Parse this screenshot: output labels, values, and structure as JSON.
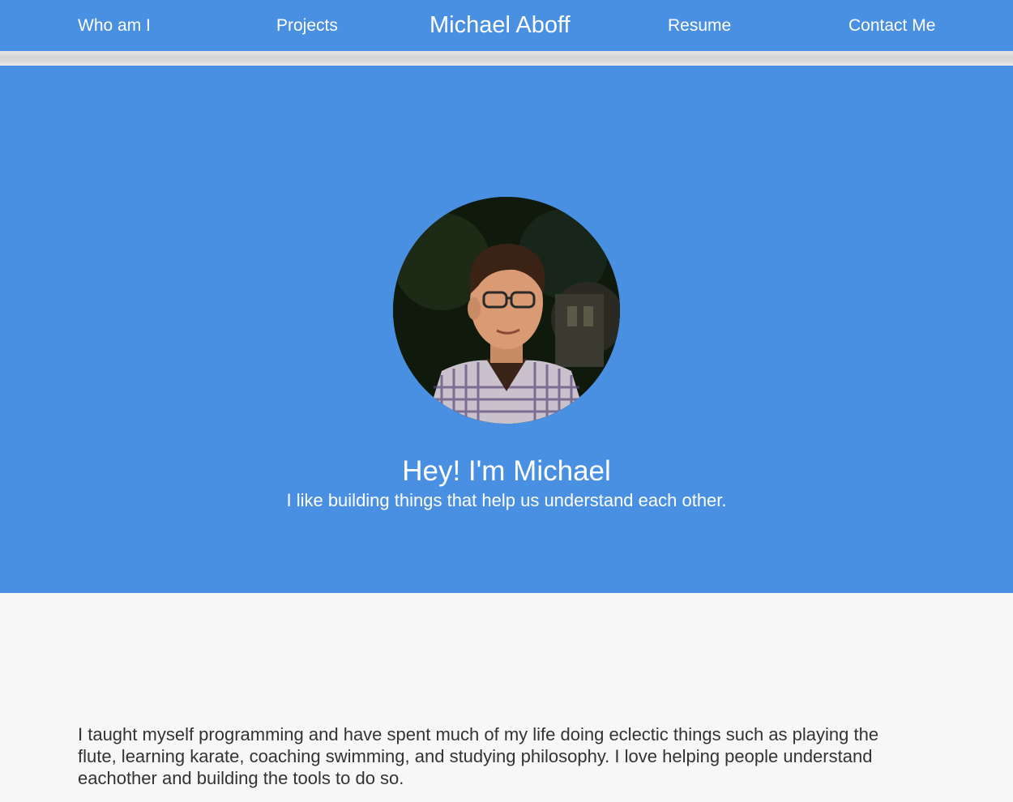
{
  "nav": {
    "who_label": "Who am I",
    "projects_label": "Projects",
    "brand": "Michael Aboff",
    "resume_label": "Resume",
    "contact_label": "Contact Me"
  },
  "hero": {
    "title": "Hey! I'm Michael",
    "subtitle": "I like building things that help us understand each other.",
    "avatar_icon": "profile-photo"
  },
  "about": {
    "text": "I taught myself programming and have spent much of my life doing eclectic things such as playing the flute, learning karate, coaching swimming, and studying philosophy. I love helping people understand eachother and building the tools to do so."
  },
  "colors": {
    "primary": "#4a90e2",
    "background": "#f7f7f7",
    "text_light": "#ffffff",
    "text_dark": "#333333"
  }
}
